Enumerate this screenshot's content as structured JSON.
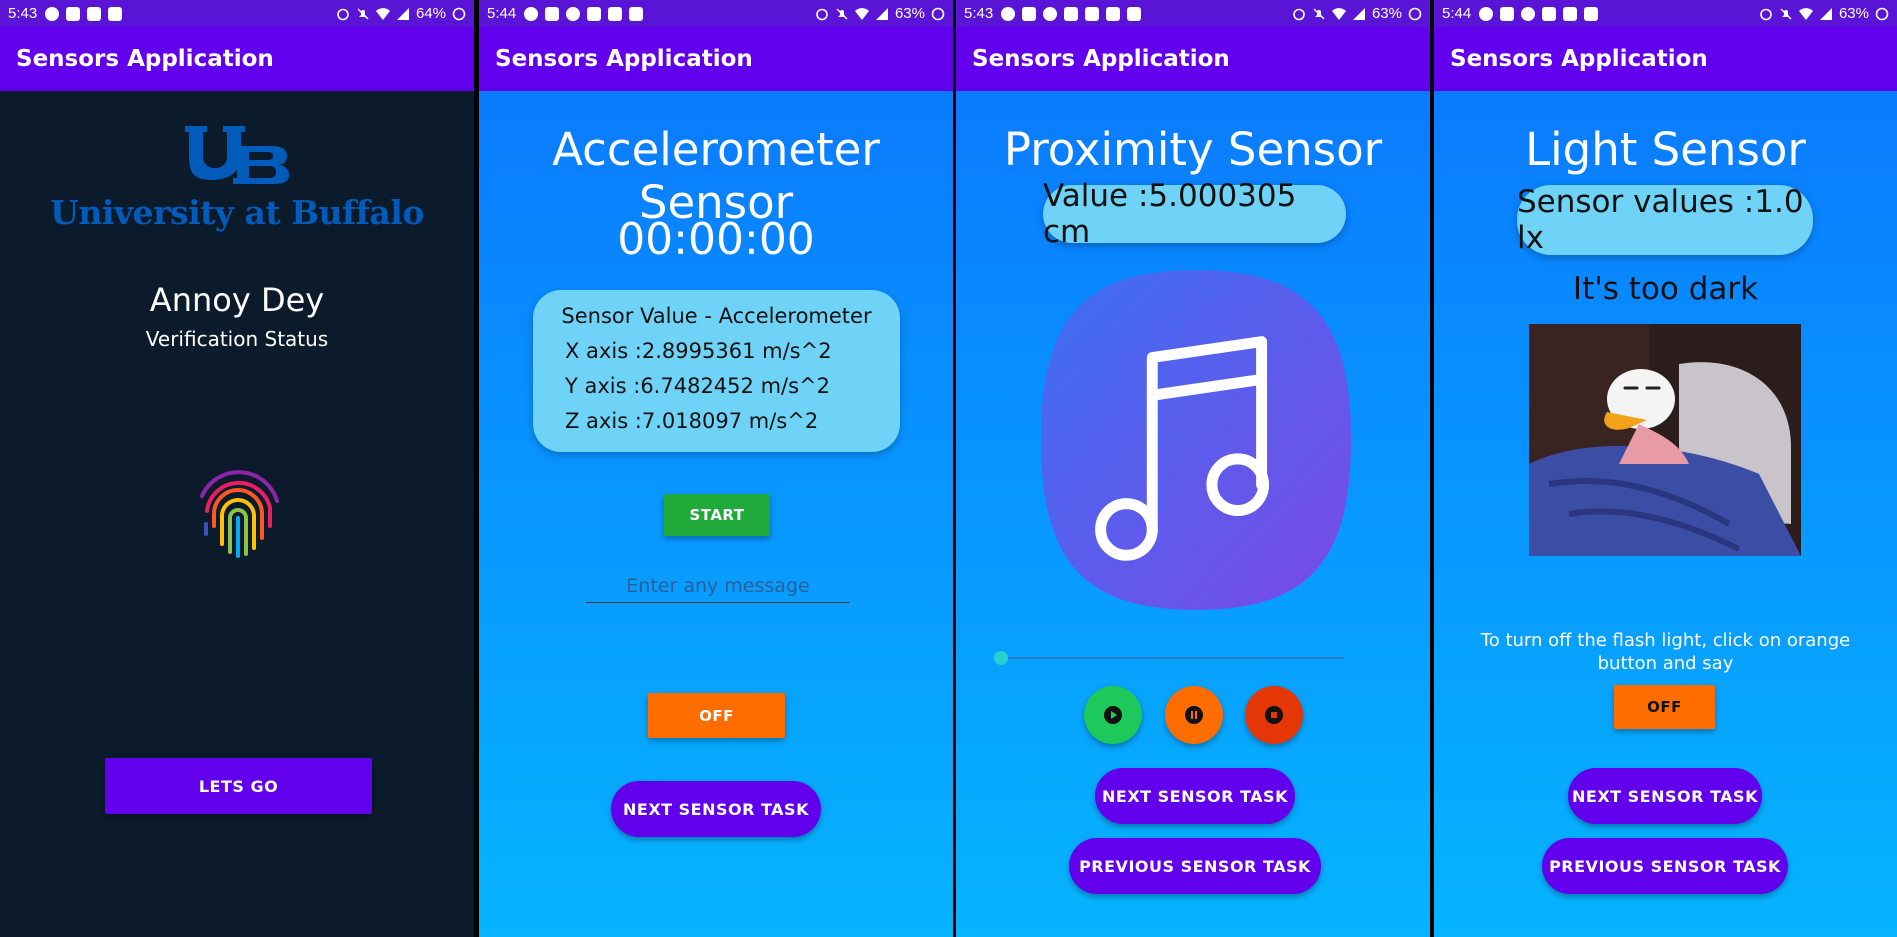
{
  "screens": [
    {
      "status": {
        "time": "5:43",
        "battery": "64%"
      },
      "app_title": "Sensors Application",
      "logo_text": "University at Buffalo",
      "user_name": "Annoy Dey",
      "subtitle": "Verification Status",
      "button": "LETS GO"
    },
    {
      "status": {
        "time": "5:44",
        "battery": "63%"
      },
      "app_title": "Sensors Application",
      "title": "Accelerometer Sensor",
      "timer": "00:00:00",
      "values": {
        "header": "Sensor Value - Accelerometer",
        "x": "X axis :2.8995361 m/s^2",
        "y": "Y axis :6.7482452 m/s^2",
        "z": "Z axis :7.018097 m/s^2"
      },
      "start_button": "START",
      "message_placeholder": "Enter any message",
      "off_button": "OFF",
      "next_button": "NEXT SENSOR TASK"
    },
    {
      "status": {
        "time": "5:43",
        "battery": "63%"
      },
      "app_title": "Sensors Application",
      "title": "Proximity Sensor",
      "value": "Value :5.000305 cm",
      "seek_progress": 0.0,
      "next_button": "NEXT SENSOR TASK",
      "prev_button": "PREVIOUS SENSOR TASK"
    },
    {
      "status": {
        "time": "5:44",
        "battery": "63%"
      },
      "app_title": "Sensors Application",
      "title": "Light Sensor",
      "value": "Sensor values :1.0 lx",
      "status_text": "It's too dark",
      "instruction": "To turn off the flash light, click on orange button and say",
      "off_button": "OFF",
      "next_button": "NEXT SENSOR TASK",
      "prev_button": "PREVIOUS SENSOR TASK"
    }
  ],
  "colors": {
    "status_bar": "#5a14d6",
    "app_bar": "#6200ee",
    "primary_button": "#6200ee",
    "orange_button": "#ff6d00",
    "start_button": "#1faa3a",
    "bubble": "#6fd3f7",
    "dark_bg": "#0b1b2b",
    "ub_blue": "#005bbb"
  },
  "icons": [
    "messenger-icon",
    "youtube-icon",
    "linkedin-icon",
    "instagram-icon",
    "image-icon",
    "calendar-icon",
    "alarm-icon",
    "mute-icon",
    "wifi-icon",
    "signal-icon",
    "battery-icon",
    "fingerprint-icon",
    "music-note-icon",
    "play-icon",
    "pause-icon",
    "stop-icon"
  ]
}
